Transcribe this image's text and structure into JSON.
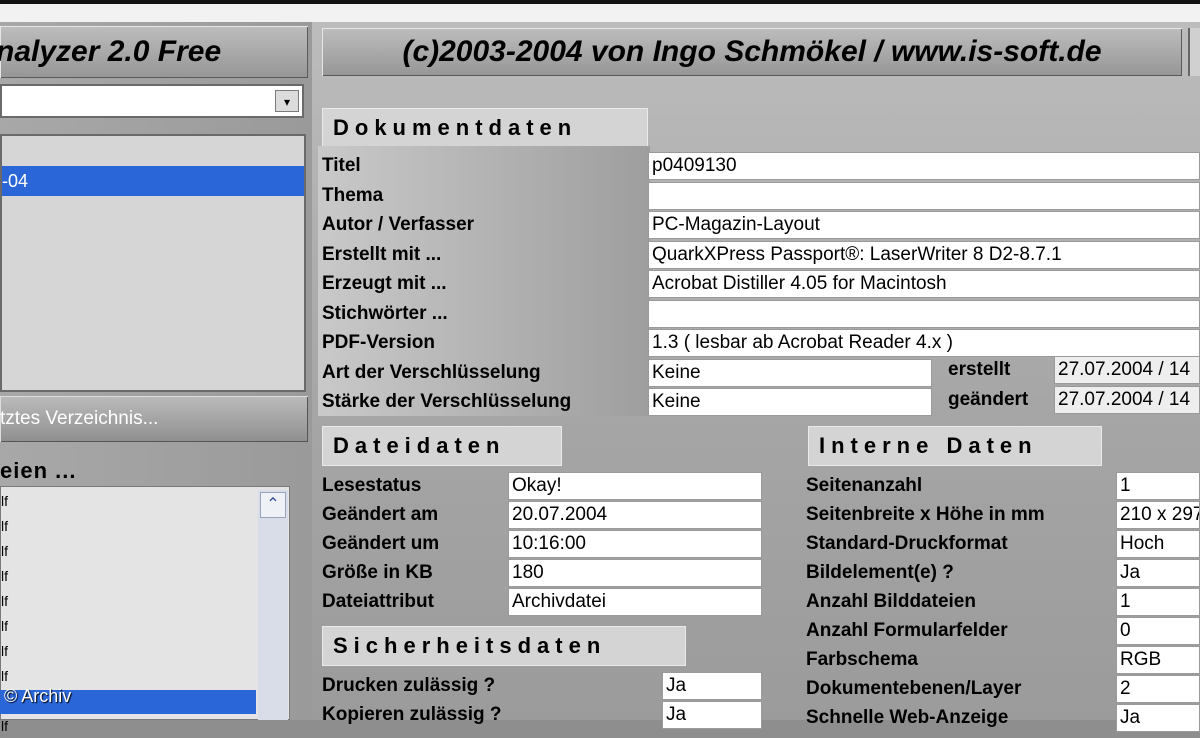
{
  "header": {
    "app_title": "nalyzer 2.0 Free",
    "copyright": "(c)2003-2004 von Ingo Schmökel / www.is-soft.de"
  },
  "left": {
    "combo_arrow": "▾",
    "list_selected": "-04",
    "last_dir_button": "tztes Verzeichnis...",
    "files_label": "eien ...",
    "file_items": [
      "lf",
      "lf",
      "lf",
      "lf",
      "lf",
      "lf",
      "lf",
      "lf",
      "lf",
      "lf"
    ],
    "scroll_up": "⌃",
    "watermark": "© Archiv"
  },
  "dokumentdaten": {
    "heading": "Dokumentdaten",
    "rows": [
      {
        "label": "Titel",
        "value": "p0409130"
      },
      {
        "label": "Thema",
        "value": ""
      },
      {
        "label": "Autor / Verfasser",
        "value": "PC-Magazin-Layout"
      },
      {
        "label": "Erstellt mit ...",
        "value": "QuarkXPress Passport®: LaserWriter 8 D2-8.7.1"
      },
      {
        "label": "Erzeugt mit ...",
        "value": "Acrobat Distiller 4.05 for Macintosh"
      },
      {
        "label": "Stichwörter ...",
        "value": ""
      },
      {
        "label": "PDF-Version",
        "value": "1.3  ( lesbar ab Acrobat Reader 4.x )"
      },
      {
        "label": "Art der Verschlüsselung",
        "value": "Keine"
      },
      {
        "label": "Stärke der Verschlüsselung",
        "value": "Keine"
      }
    ],
    "erstellt_label": "erstellt",
    "erstellt_value": "27.07.2004 / 14",
    "geaendert_label": "geändert",
    "geaendert_value": "27.07.2004 / 14"
  },
  "dateidaten": {
    "heading": "Dateidaten",
    "rows": [
      {
        "label": "Lesestatus",
        "value": "Okay!"
      },
      {
        "label": "Geändert am",
        "value": "20.07.2004"
      },
      {
        "label": "Geändert um",
        "value": "10:16:00"
      },
      {
        "label": "Größe in KB",
        "value": "180"
      },
      {
        "label": "Dateiattribut",
        "value": "Archivdatei"
      }
    ]
  },
  "sicherheitsdaten": {
    "heading": "Sicherheitsdaten",
    "rows": [
      {
        "label": "Drucken zulässig ?",
        "value": "Ja"
      },
      {
        "label": "Kopieren zulässig ?",
        "value": "Ja"
      }
    ]
  },
  "internedaten": {
    "heading": "Interne Daten",
    "rows": [
      {
        "label": "Seitenanzahl",
        "value": "1"
      },
      {
        "label": "Seitenbreite x Höhe in mm",
        "value": "210 x 297"
      },
      {
        "label": "Standard-Druckformat",
        "value": "Hoch"
      },
      {
        "label": "Bildelement(e) ?",
        "value": "Ja"
      },
      {
        "label": "Anzahl Bilddateien",
        "value": "1"
      },
      {
        "label": "Anzahl Formularfelder",
        "value": "0"
      },
      {
        "label": "Farbschema",
        "value": "RGB"
      },
      {
        "label": "Dokumentebenen/Layer",
        "value": "2"
      },
      {
        "label": "Schnelle Web-Anzeige",
        "value": "Ja"
      }
    ]
  }
}
